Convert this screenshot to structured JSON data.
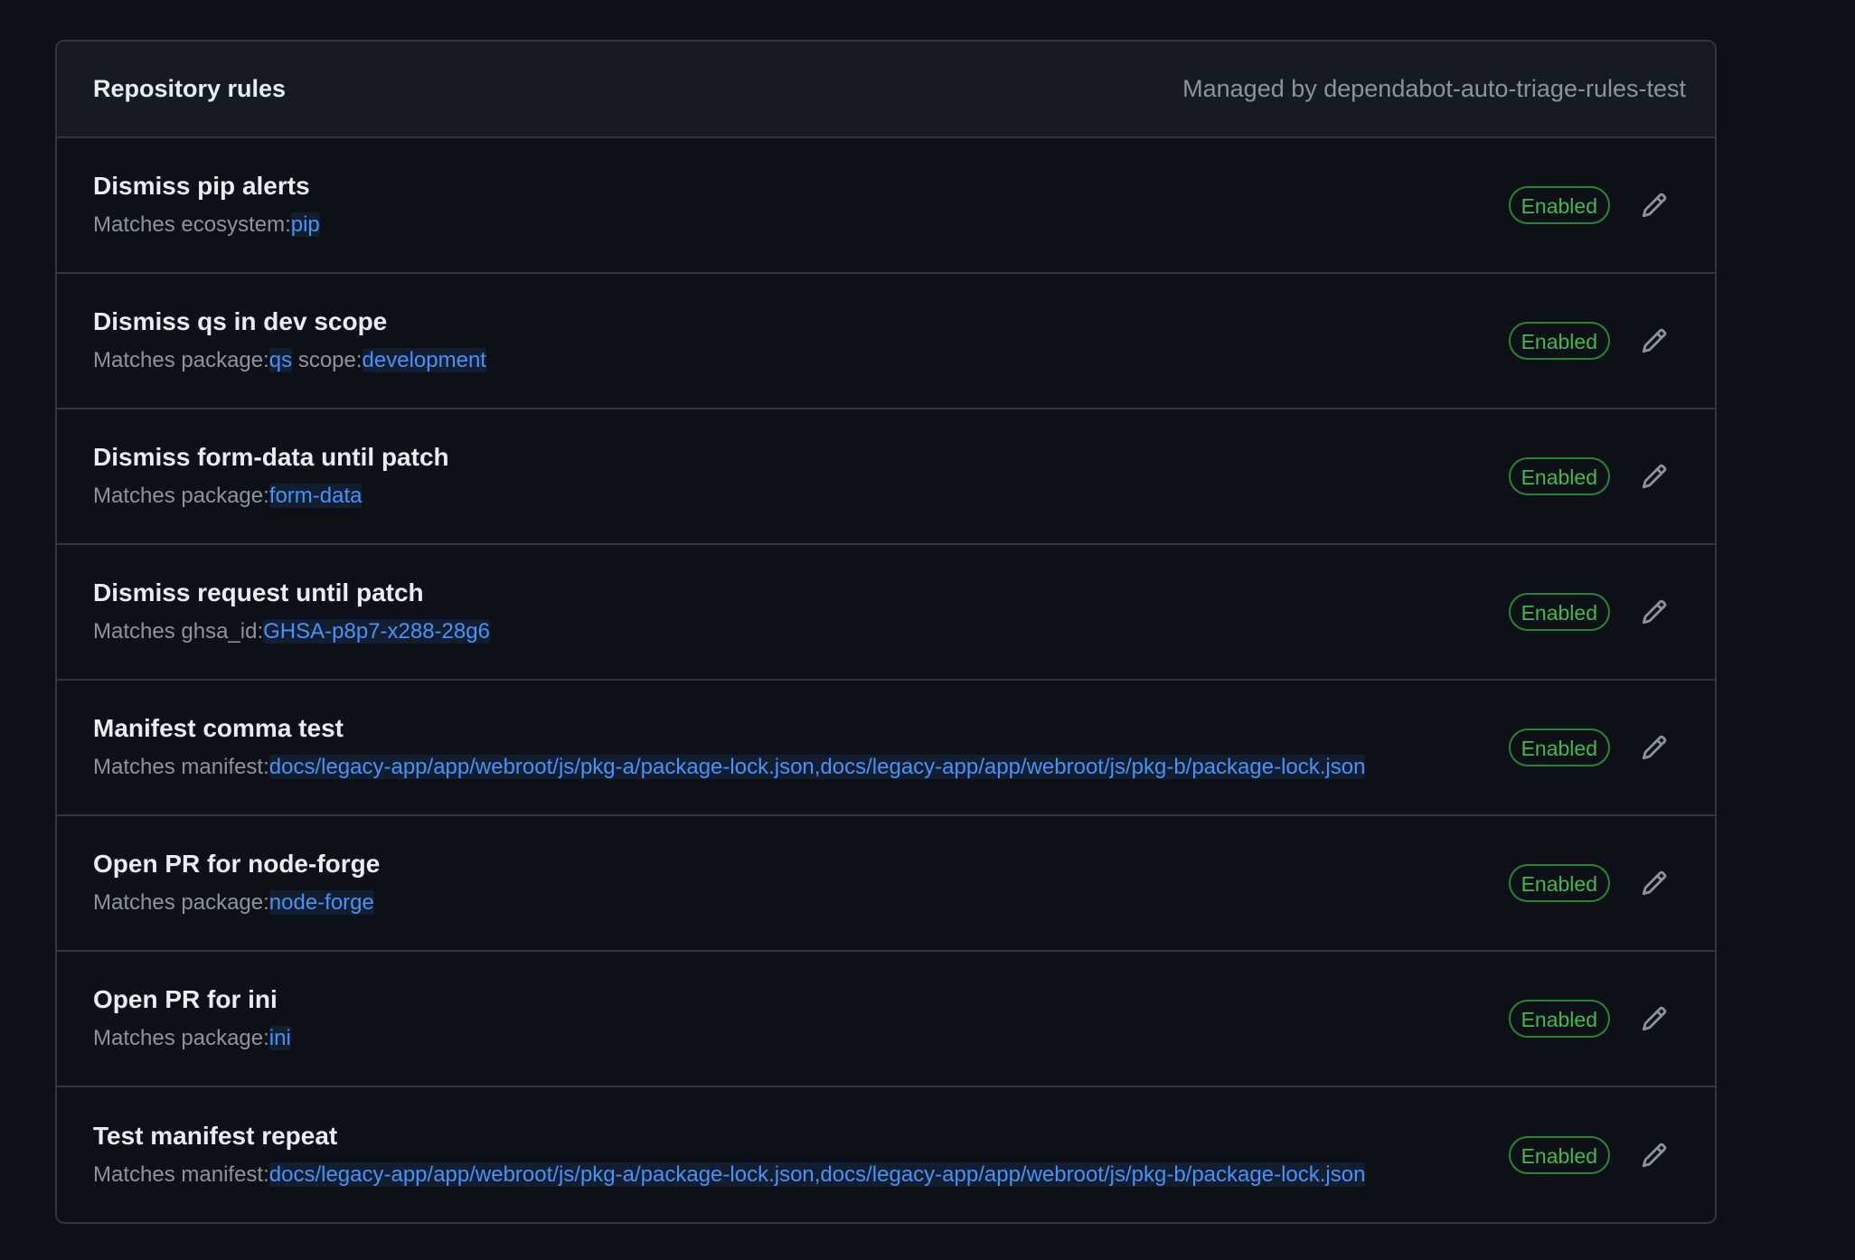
{
  "header": {
    "title": "Repository rules",
    "managed_by": "Managed by dependabot-auto-triage-rules-test"
  },
  "colors": {
    "background": "#0d1117",
    "header_bg": "#161b22",
    "border": "#30363d",
    "enabled_green": "#3fb950",
    "link_blue": "#4493f8"
  },
  "rules": [
    {
      "title": "Dismiss pip alerts",
      "matches_prefix": "Matches",
      "qualifiers": [
        {
          "key": "ecosystem:",
          "value": "pip"
        }
      ],
      "status": "Enabled",
      "edit_icon": "pencil-icon"
    },
    {
      "title": "Dismiss qs in dev scope",
      "matches_prefix": "Matches",
      "qualifiers": [
        {
          "key": "package:",
          "value": "qs"
        },
        {
          "key": "scope:",
          "value": "development"
        }
      ],
      "status": "Enabled",
      "edit_icon": "pencil-icon"
    },
    {
      "title": "Dismiss form-data until patch",
      "matches_prefix": "Matches",
      "qualifiers": [
        {
          "key": "package:",
          "value": "form-data"
        }
      ],
      "status": "Enabled",
      "edit_icon": "pencil-icon"
    },
    {
      "title": "Dismiss request until patch",
      "matches_prefix": "Matches",
      "qualifiers": [
        {
          "key": "ghsa_id:",
          "value": "GHSA-p8p7-x288-28g6"
        }
      ],
      "status": "Enabled",
      "edit_icon": "pencil-icon"
    },
    {
      "title": "Manifest comma test",
      "matches_prefix": "Matches",
      "qualifiers": [
        {
          "key": "manifest:",
          "value": "docs/legacy-app/app/webroot/js/pkg-a/package-lock.json,docs/legacy-app/app/webroot/js/pkg-b/package-lock.json"
        }
      ],
      "status": "Enabled",
      "edit_icon": "pencil-icon"
    },
    {
      "title": "Open PR for node-forge",
      "matches_prefix": "Matches",
      "qualifiers": [
        {
          "key": "package:",
          "value": "node-forge"
        }
      ],
      "status": "Enabled",
      "edit_icon": "pencil-icon"
    },
    {
      "title": "Open PR for ini",
      "matches_prefix": "Matches",
      "qualifiers": [
        {
          "key": "package:",
          "value": "ini"
        }
      ],
      "status": "Enabled",
      "edit_icon": "pencil-icon"
    },
    {
      "title": "Test manifest repeat",
      "matches_prefix": "Matches",
      "qualifiers": [
        {
          "key": "manifest:",
          "value": "docs/legacy-app/app/webroot/js/pkg-a/package-lock.json,docs/legacy-app/app/webroot/js/pkg-b/package-lock.json"
        }
      ],
      "status": "Enabled",
      "edit_icon": "pencil-icon"
    }
  ]
}
